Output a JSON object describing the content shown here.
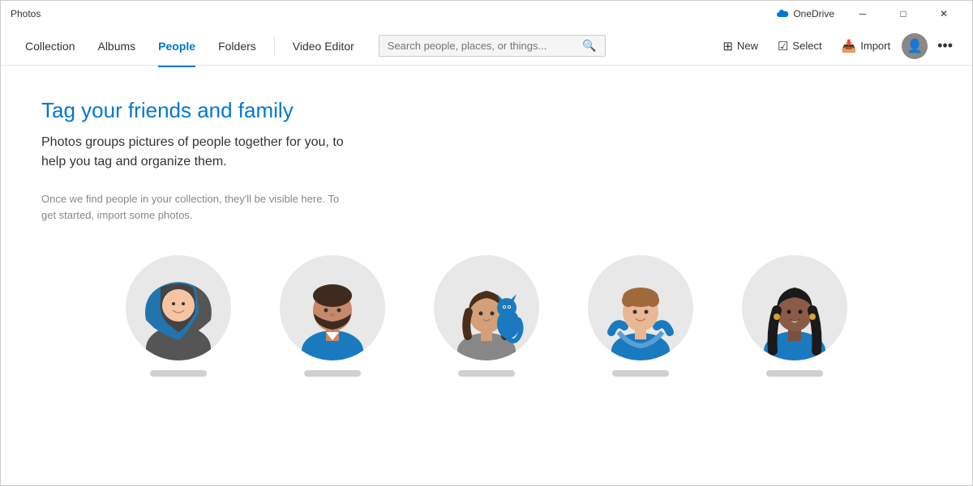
{
  "app": {
    "title": "Photos"
  },
  "titlebar": {
    "onedrive_label": "OneDrive",
    "minimize": "─",
    "maximize": "□",
    "close": "✕"
  },
  "nav": {
    "items": [
      {
        "id": "collection",
        "label": "Collection",
        "active": false
      },
      {
        "id": "albums",
        "label": "Albums",
        "active": false
      },
      {
        "id": "people",
        "label": "People",
        "active": true
      },
      {
        "id": "folders",
        "label": "Folders",
        "active": false
      },
      {
        "id": "video-editor",
        "label": "Video Editor",
        "active": false
      }
    ],
    "search_placeholder": "Search people, places, or things..."
  },
  "toolbar": {
    "new_label": "New",
    "select_label": "Select",
    "import_label": "Import"
  },
  "content": {
    "heading": "Tag your friends and family",
    "description": "Photos groups pictures of people together for you, to help you tag and organize them.",
    "sub_description": "Once we find people in your collection, they'll be visible here. To get started, import some photos."
  },
  "avatars": [
    {
      "id": "avatar-hijab",
      "label": ""
    },
    {
      "id": "avatar-bearded",
      "label": ""
    },
    {
      "id": "avatar-cat",
      "label": ""
    },
    {
      "id": "avatar-boy",
      "label": ""
    },
    {
      "id": "avatar-woman",
      "label": ""
    }
  ]
}
